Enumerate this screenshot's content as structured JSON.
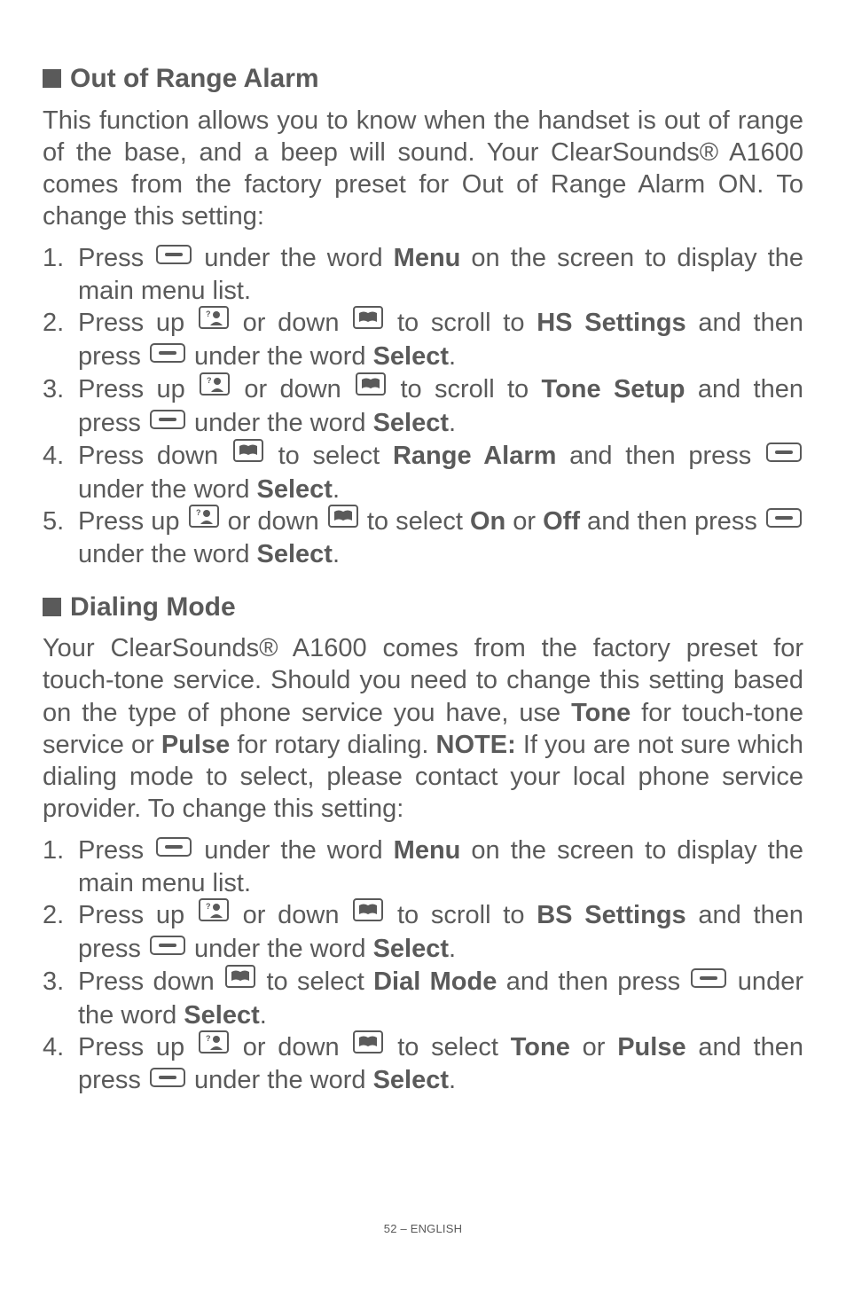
{
  "section1": {
    "title": "Out of Range Alarm",
    "intro": "This function allows you to know when the handset is out of range of the base, and a beep will sound.  Your ClearSounds® A1600 comes from the factory preset for Out of Range Alarm ON.  To change this setting:",
    "steps": [
      {
        "n": "1.",
        "parts": [
          "Press ",
          "ICON_SOFT",
          " under the word ",
          "B:Menu",
          " on the screen to display the main menu list."
        ]
      },
      {
        "n": "2.",
        "parts": [
          "Press up ",
          "ICON_UP",
          " or down ",
          "ICON_DOWN",
          " to scroll to ",
          "B:HS Settings",
          " and then press ",
          "ICON_SOFT",
          " under the word ",
          "B:Select",
          "."
        ]
      },
      {
        "n": "3.",
        "parts": [
          "Press up ",
          "ICON_UP",
          " or down ",
          "ICON_DOWN",
          " to scroll to ",
          "B:Tone Setup",
          " and then press ",
          "ICON_SOFT",
          " under the word ",
          "B:Select",
          "."
        ]
      },
      {
        "n": "4.",
        "parts": [
          "Press down ",
          "ICON_DOWN",
          " to select ",
          "B:Range Alarm",
          " and then press ",
          "ICON_SOFT",
          " under the word ",
          "B:Select",
          "."
        ]
      },
      {
        "n": "5.",
        "parts": [
          "Press up ",
          "ICON_UP",
          " or down ",
          "ICON_DOWN",
          " to select ",
          "B:On",
          " or ",
          "B:Off",
          " and then press ",
          "ICON_SOFT",
          " under the word ",
          "B:Select",
          "."
        ]
      }
    ]
  },
  "section2": {
    "title": "Dialing Mode",
    "intro_parts": [
      "Your ClearSounds® A1600 comes from the factory preset for touch-tone service. Should you need to change this setting based on the type of phone service you have, use ",
      "B:Tone",
      " for touch-tone service or ",
      "B:Pulse",
      " for rotary dialing.   ",
      "B:NOTE:",
      " If you are not sure which dialing mode to select, please contact your local phone service provider.  To change this setting:"
    ],
    "steps": [
      {
        "n": "1.",
        "parts": [
          "Press ",
          "ICON_SOFT",
          " under the word ",
          "B:Menu",
          " on the screen to display the main menu list."
        ]
      },
      {
        "n": "2.",
        "parts": [
          "Press up ",
          "ICON_UP",
          " or down ",
          "ICON_DOWN",
          " to scroll to ",
          "B:BS Settings",
          " and then press ",
          "ICON_SOFT",
          " under the word ",
          "B:Select",
          "."
        ]
      },
      {
        "n": "3.",
        "parts": [
          "Press down ",
          "ICON_DOWN",
          " to select ",
          "B:Dial Mode",
          " and then press ",
          "ICON_SOFT",
          " under the word ",
          "B:Select",
          "."
        ]
      },
      {
        "n": "4.",
        "parts": [
          "Press up ",
          "ICON_UP",
          " or down ",
          "ICON_DOWN",
          " to select ",
          "B:Tone",
          " or ",
          "B:Pulse",
          " and then press ",
          "ICON_SOFT",
          " under the word ",
          "B:Select",
          "."
        ]
      }
    ]
  },
  "footer": "52 – ENGLISH",
  "icons": {
    "soft_name": "softkey-icon",
    "up_name": "up-person-icon",
    "down_name": "down-book-icon"
  }
}
